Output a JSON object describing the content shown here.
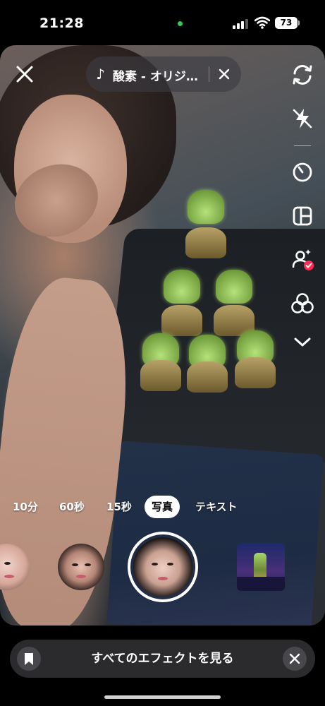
{
  "status_bar": {
    "time": "21:28",
    "battery": "73",
    "camera_indicator_color": "#35c759"
  },
  "camera": {
    "sound": {
      "title": "酸素 - オリジ…",
      "icon": "music-note-icon"
    },
    "toolbar": [
      {
        "name": "flip-camera-icon"
      },
      {
        "name": "flash-off-icon"
      },
      {
        "name": "timer-icon"
      },
      {
        "name": "layout-icon"
      },
      {
        "name": "collab-icon"
      },
      {
        "name": "filters-icon"
      },
      {
        "name": "chevron-down-icon"
      }
    ],
    "modes": [
      {
        "label": "10分",
        "active": false
      },
      {
        "label": "60秒",
        "active": false
      },
      {
        "label": "15秒",
        "active": false
      },
      {
        "label": "写真",
        "active": true
      },
      {
        "label": "テキスト",
        "active": false
      }
    ]
  },
  "effects_bar": {
    "label": "すべてのエフェクトを見る"
  },
  "colors": {
    "accent_badge": "#fe2c55",
    "bar_background": "#2b2b2e"
  }
}
